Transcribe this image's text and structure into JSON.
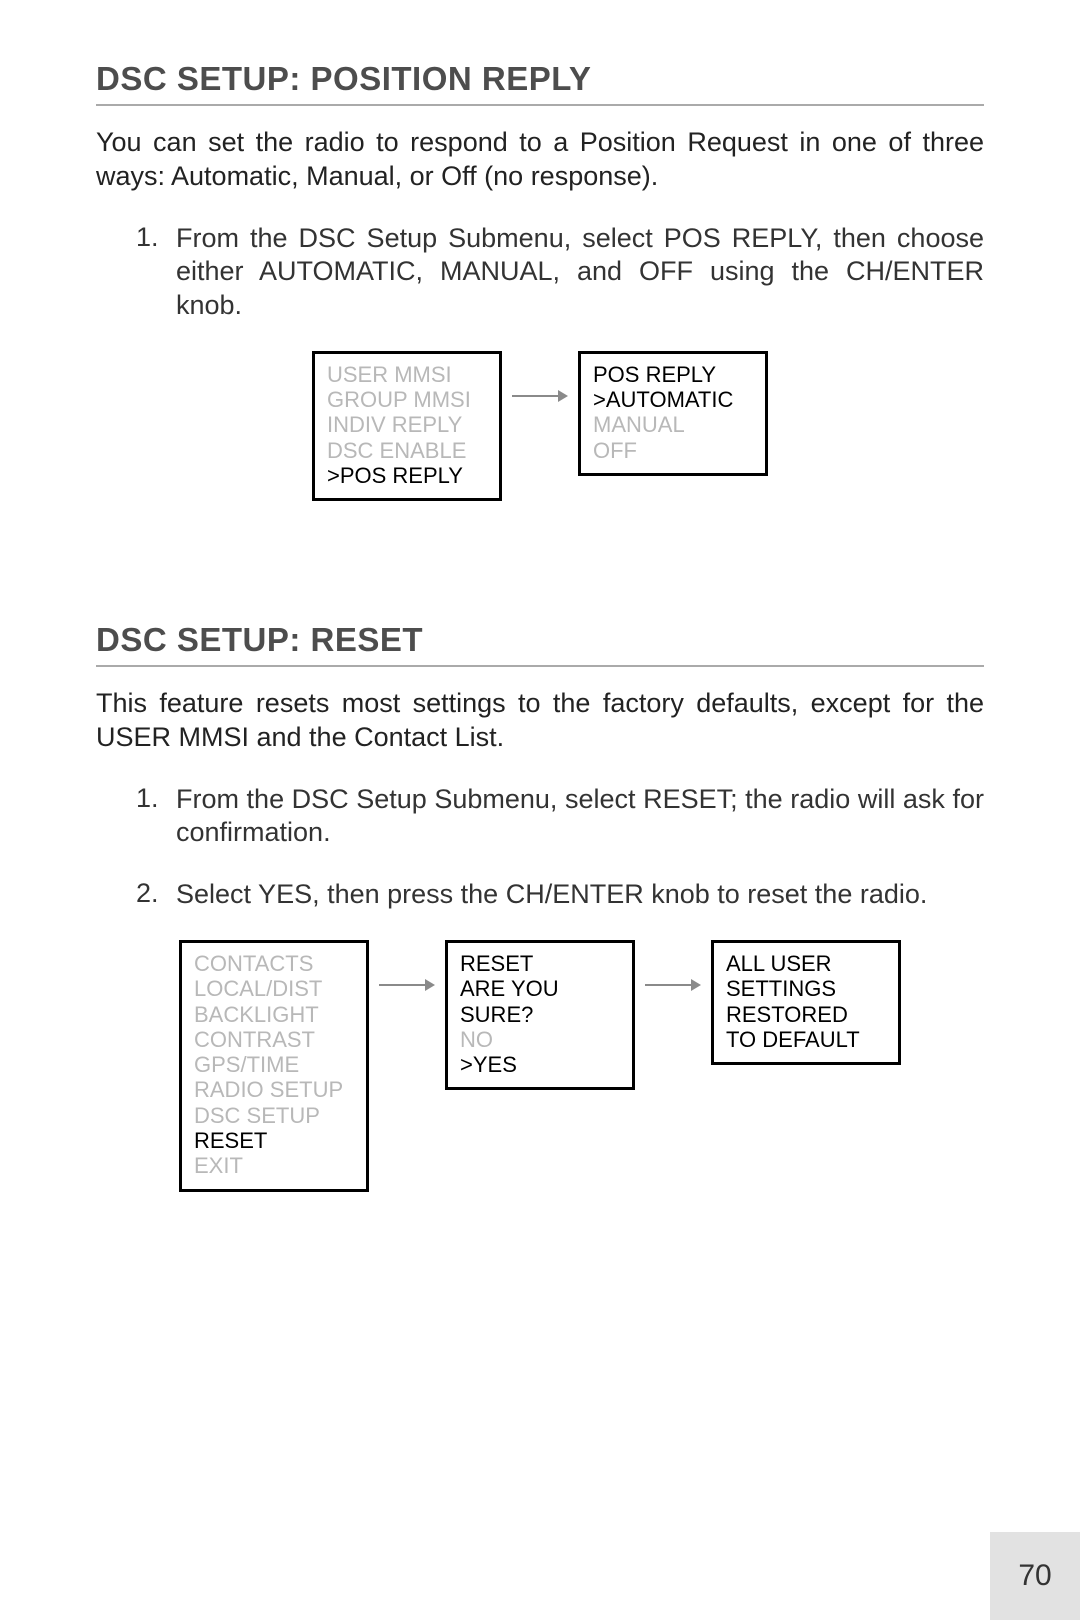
{
  "page_number": "70",
  "section1": {
    "heading": "DSC SETUP: POSITION REPLY",
    "intro": "You can set the radio to respond to a Position Request in one of three ways: Automatic, Manual, or Off (no response).",
    "step1_num": "1.",
    "step1_text": "From the DSC Setup Submenu, select POS REPLY, then choose either AUTOMATIC, MANUAL, and OFF using the CH/ENTER knob.",
    "lcd_a": {
      "l1": "USER MMSI",
      "l2": "GROUP MMSI",
      "l3": "INDIV REPLY",
      "l4": "DSC ENABLE",
      "l5": ">POS REPLY"
    },
    "lcd_b": {
      "l1": "POS REPLY",
      "l2": ">AUTOMATIC",
      "l3": "MANUAL",
      "l4": "OFF"
    }
  },
  "section2": {
    "heading": "DSC SETUP: RESET",
    "intro": "This feature resets most settings to the factory defaults, except for the USER MMSI and the Contact List.",
    "step1_num": "1.",
    "step1_text": "From the DSC Setup Submenu, select RESET; the radio will ask for confirmation.",
    "step2_num": "2.",
    "step2_text": "Select YES, then press the CH/ENTER knob to reset the radio.",
    "lcd_a": {
      "l1": "CONTACTS",
      "l2": "LOCAL/DIST",
      "l3": "BACKLIGHT",
      "l4": "CONTRAST",
      "l5": "GPS/TIME",
      "l6": "RADIO SETUP",
      "l7": "DSC SETUP",
      "l8": "RESET",
      "l9": "EXIT"
    },
    "lcd_b": {
      "l1": "RESET",
      "l2": "ARE YOU",
      "l3": "SURE?",
      "l4": "NO",
      "l5": ">YES"
    },
    "lcd_c": {
      "l1": "ALL USER",
      "l2": "SETTINGS",
      "l3": "RESTORED",
      "l4": "TO DEFAULT"
    }
  }
}
